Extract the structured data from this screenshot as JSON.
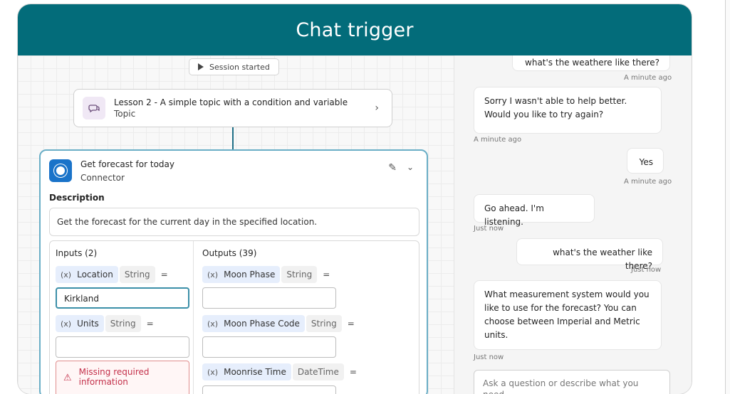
{
  "header": {
    "title": "Chat trigger"
  },
  "canvas": {
    "session": {
      "label": "Session started"
    },
    "topic": {
      "title": "Lesson 2 - A simple topic with a condition and variable",
      "subtitle": "Topic"
    },
    "connector_card": {
      "title": "Get forecast for today",
      "subtitle": "Connector",
      "description_label": "Description",
      "description": "Get the forecast for the current day in the specified location.",
      "inputs_title": "Inputs (2)",
      "outputs_title": "Outputs (39)",
      "inputs": [
        {
          "var": "(x)",
          "name": "Location",
          "type": "String",
          "eq": "=",
          "value": "Kirkland"
        },
        {
          "var": "(x)",
          "name": "Units",
          "type": "String",
          "eq": "=",
          "value": ""
        }
      ],
      "error": {
        "icon": "⚠",
        "text": "Missing required information"
      },
      "outputs": [
        {
          "var": "(x)",
          "name": "Moon Phase",
          "type": "String",
          "eq": "="
        },
        {
          "var": "(x)",
          "name": "Moon Phase Code",
          "type": "String",
          "eq": "="
        },
        {
          "var": "(x)",
          "name": "Moonrise Time",
          "type": "DateTime",
          "eq": "="
        }
      ]
    }
  },
  "chat": {
    "messages": [
      {
        "role": "user",
        "text": "what's the weathere like there?",
        "time": "A minute ago"
      },
      {
        "role": "bot",
        "text": "Sorry I wasn't able to help better. Would you like to try again?",
        "time": "A minute ago"
      },
      {
        "role": "user",
        "text": "Yes",
        "time": "A minute ago"
      },
      {
        "role": "bot",
        "text": "Go ahead. I'm listening.",
        "time": "Just now"
      },
      {
        "role": "user",
        "text": "what's the weather like there?",
        "time": "Just now"
      },
      {
        "role": "bot",
        "text": "What measurement system would you like to use for the forecast? You can choose between Imperial and Metric units.",
        "time": "Just now"
      }
    ],
    "composer_placeholder": "Ask a question or describe what you need"
  }
}
